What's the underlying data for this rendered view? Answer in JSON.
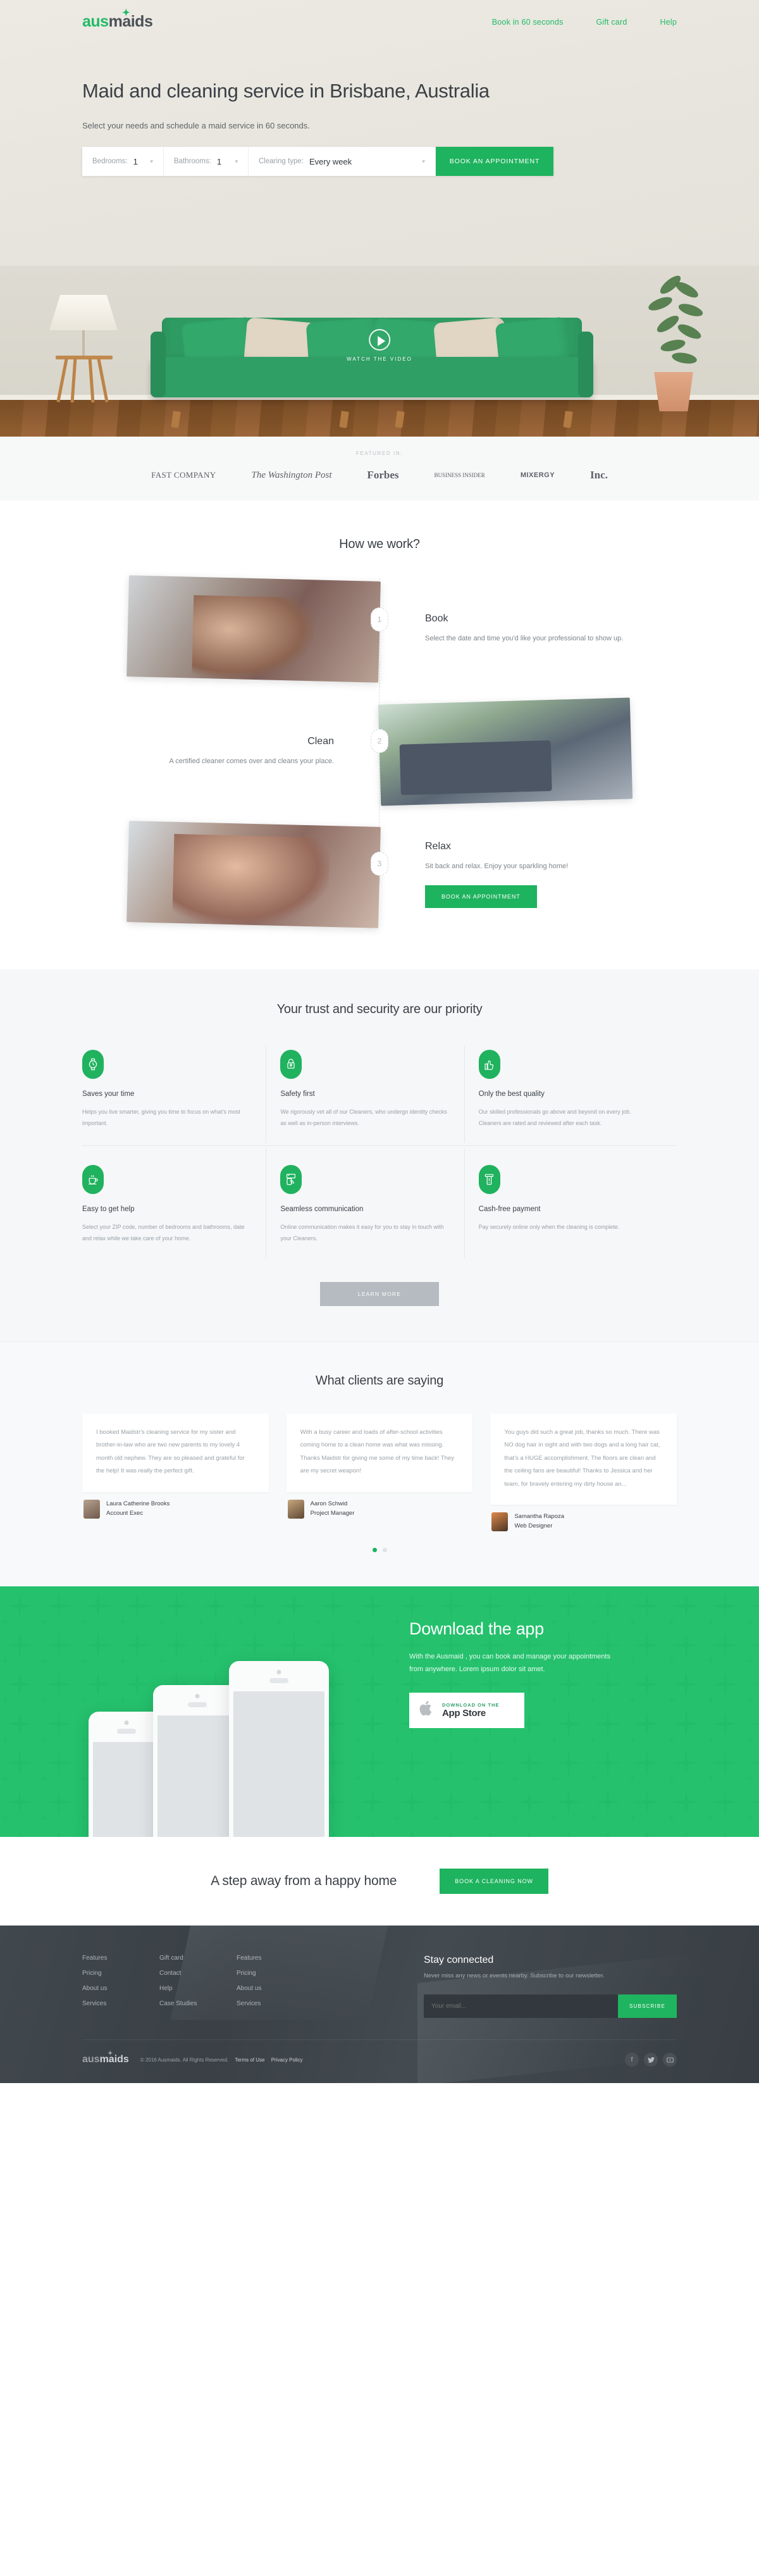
{
  "brand": {
    "name_a": "aus",
    "name_b": "maids",
    "spark": "✦",
    "accent": "#1eb35e"
  },
  "nav": {
    "items": [
      {
        "label": "Book in 60 seconds"
      },
      {
        "label": "Gift card"
      },
      {
        "label": "Help"
      }
    ]
  },
  "hero": {
    "title": "Maid and cleaning service in Brisbane, Australia",
    "subtitle": "Select your needs and schedule a maid service in 60 seconds.",
    "form": {
      "bedrooms_label": "Bedrooms:",
      "bedrooms_value": "1",
      "bathrooms_label": "Bathrooms:",
      "bathrooms_value": "1",
      "cleaning_label": "Clearing type:",
      "cleaning_value": "Every week",
      "cta": "BOOK AN APPOINTMENT"
    },
    "video_label": "WATCH THE VIDEO"
  },
  "featured": {
    "heading": "FEATURED IN:",
    "logos": [
      {
        "name": "FAST COMPANY"
      },
      {
        "name": "The Washington Post"
      },
      {
        "name": "Forbes"
      },
      {
        "name": "BUSINESS INSIDER"
      },
      {
        "name": "MIXERGY"
      },
      {
        "name": "Inc."
      }
    ]
  },
  "how": {
    "title": "How we work?",
    "steps": [
      {
        "num": "1",
        "title": "Book",
        "text": "Select the date and time you'd like your professional to show up."
      },
      {
        "num": "2",
        "title": "Clean",
        "text": "A certified cleaner comes over and cleans your place."
      },
      {
        "num": "3",
        "title": "Relax",
        "text": "Sit back and relax. Enjoy your sparkling home!"
      }
    ],
    "cta": "BOOK AN APPOINTMENT"
  },
  "trust": {
    "title": "Your trust and security are our priority",
    "features": [
      {
        "icon": "watch-icon",
        "title": "Saves your time",
        "text": "Helps you live smarter, giving you time to focus on what's most important."
      },
      {
        "icon": "lock-icon",
        "title": "Safety first",
        "text": "We rigorously vet all of our Cleaners, who undergo identity checks as well as in-person interviews."
      },
      {
        "icon": "thumbs-up-icon",
        "title": "Only the best quality",
        "text": "Our skilled professionals go above and beyond on every job. Cleaners are rated and reviewed after each task."
      },
      {
        "icon": "coffee-cup-icon",
        "title": "Easy to get help",
        "text": "Select your ZIP code, number of bedrooms and bathrooms, date and relax while we take care of your home."
      },
      {
        "icon": "mobile-signal-icon",
        "title": "Seamless communication",
        "text": "Online communication makes it easy for you to stay in touch with your Cleaners."
      },
      {
        "icon": "card-reader-icon",
        "title": "Cash-free payment",
        "text": "Pay securely online only when the cleaning is complete."
      }
    ],
    "learn_more": "LEARN MORE"
  },
  "testimonials": {
    "title": "What clients are saying",
    "items": [
      {
        "quote": "I booked Maidstr's cleaning service for my sister and brother-in-law who are two new parents to my lovely 4 month old nephew. They are so pleased and grateful for the help! It was really the perfect gift.",
        "name": "Laura Catherine Brooks",
        "role": "Account Exec"
      },
      {
        "quote": "With a busy career and loads of after-school activities coming home to a clean home was what was missing. Thanks Maidstr for giving me some of my time back! They are my secret weapon!",
        "name": "Aaron Schwid",
        "role": "Project Manager"
      },
      {
        "quote": "You guys did such a great job, thanks so much. There was NO dog hair in sight and with two dogs and a long hair cat, that's a HUGE accomplishment. The floors are clean and the ceiling fans are beautiful! Thanks to Jessica and her team, for bravely entering my dirty house an...",
        "name": "Samantha Rapoza",
        "role": "Web Designer"
      }
    ],
    "dots": [
      {
        "active": true
      },
      {
        "active": false
      }
    ]
  },
  "app": {
    "title": "Download the app",
    "text": "With the Ausmaid , you can book and manage your appointments from anywhere. Lorem ipsum dolor sit amet.",
    "store_small": "DOWNLOAD ON THE",
    "store_big": "App Store",
    "apple_glyph": ""
  },
  "cta": {
    "title": "A step away from a happy home",
    "button": "BOOK A CLEANING NOW"
  },
  "footer": {
    "columns": [
      {
        "links": [
          "Features",
          "Pricing",
          "About us",
          "Services"
        ]
      },
      {
        "links": [
          "Gift card",
          "Contact",
          "Help",
          "Case Studies"
        ]
      },
      {
        "links": [
          "Features",
          "Pricing",
          "About us",
          "Services"
        ]
      }
    ],
    "stay": {
      "title": "Stay connected",
      "text": "Never miss any news or events nearby. Subscribe to our newsletter.",
      "placeholder": "Your email...",
      "button": "SUBSCRIBE"
    },
    "copyright": "© 2016 Ausmaids. All Rights Reserved.",
    "terms": "Terms of Use",
    "privacy": "Privacy Policy",
    "social": [
      {
        "name": "facebook-icon",
        "glyph": "f"
      },
      {
        "name": "twitter-icon",
        "glyph": "ᴠ"
      },
      {
        "name": "youtube-icon",
        "glyph": "▸"
      }
    ]
  }
}
